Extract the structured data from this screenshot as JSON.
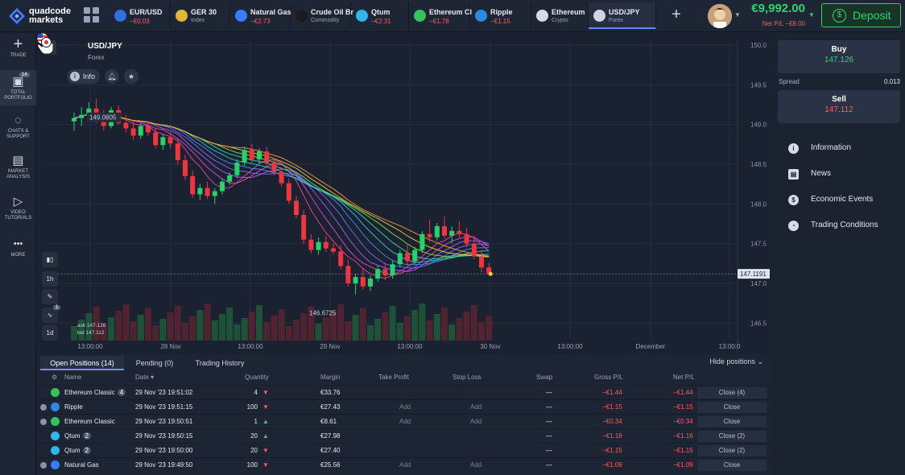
{
  "app": {
    "brand_line1": "quadcode",
    "brand_line2": "markets"
  },
  "tabs": [
    {
      "name": "EUR/USD",
      "sub": "−€0.03",
      "sub_type": "pl",
      "color": "#2f6fe0",
      "active": false
    },
    {
      "name": "GER 30",
      "sub": "Index",
      "sub_type": "cat",
      "color": "#e3b63a",
      "active": false
    },
    {
      "name": "Natural Gas",
      "sub": "−€2.73",
      "sub_type": "pl",
      "color": "#3b7bff",
      "active": false
    },
    {
      "name": "Crude Oil Br",
      "sub": "Commodity",
      "sub_type": "cat",
      "color": "#1b1b1b",
      "active": false
    },
    {
      "name": "Qtum",
      "sub": "−€2.31",
      "sub_type": "pl",
      "color": "#2fb7e8",
      "active": false
    },
    {
      "name": "Ethereum Cl",
      "sub": "−€1.78",
      "sub_type": "pl",
      "color": "#33c45e",
      "active": false
    },
    {
      "name": "Ripple",
      "sub": "−€1.15",
      "sub_type": "pl",
      "color": "#2a8be6",
      "active": false
    },
    {
      "name": "Ethereum",
      "sub": "Crypto",
      "sub_type": "cat",
      "color": "#d8dbe2",
      "active": false
    },
    {
      "name": "USD/JPY",
      "sub": "Forex",
      "sub_type": "cat",
      "color": "#d0d5e0",
      "active": true
    }
  ],
  "account": {
    "balance": "€9,992.00",
    "net_pl": "Net P/L −€8.00",
    "deposit_label": "Deposit"
  },
  "sidebar": [
    {
      "key": "trade",
      "glyph": "+",
      "label": "TRADE"
    },
    {
      "key": "portfolio",
      "glyph": "▣",
      "label": "TOTAL PORTFOLIO",
      "badge": "14"
    },
    {
      "key": "chats",
      "glyph": "◌",
      "label": "CHATS & SUPPORT"
    },
    {
      "key": "market",
      "glyph": "▤",
      "label": "MARKET ANALYSIS"
    },
    {
      "key": "video",
      "glyph": "▷",
      "label": "VIDEO TUTORIALS"
    },
    {
      "key": "more",
      "glyph": "•••",
      "label": "MORE"
    }
  ],
  "chart_header": {
    "pair": "USD/JPY",
    "category": "Forex",
    "info_label": "Info"
  },
  "chart_tools": {
    "timeframe_1": "1h",
    "timeframe_2": "1d",
    "indicator_badge": "1"
  },
  "chart_data": {
    "type": "candlestick",
    "price_ticks": [
      "150.0",
      "149.5",
      "149.0",
      "148.5",
      "148.0",
      "147.5",
      "147.0",
      "146.5"
    ],
    "time_ticks": [
      "13:00:00",
      "28 Nov",
      "13:00:00",
      "29 Nov",
      "13:00:00",
      "30 Nov",
      "13:00:00",
      "December",
      "13:00:0"
    ],
    "ylim": [
      146.3,
      150.05
    ],
    "current_price": 147.1191,
    "current_price_label": "147.1191",
    "high_label": "149.0805",
    "low_label": "146.6725",
    "ask_label": "ask 147.126",
    "bid_label": "bid 147.112",
    "candles_ohlc": [
      [
        149.04,
        149.15,
        148.92,
        149.08
      ],
      [
        149.08,
        149.22,
        148.98,
        149.12
      ],
      [
        149.12,
        149.28,
        149.05,
        149.2
      ],
      [
        149.2,
        149.32,
        149.02,
        149.05
      ],
      [
        149.05,
        149.18,
        148.92,
        148.98
      ],
      [
        148.98,
        149.22,
        148.95,
        149.18
      ],
      [
        149.18,
        149.24,
        149.0,
        149.02
      ],
      [
        149.02,
        149.12,
        148.9,
        148.95
      ],
      [
        148.95,
        149.05,
        148.8,
        148.86
      ],
      [
        148.86,
        149.02,
        148.82,
        148.98
      ],
      [
        148.98,
        149.04,
        148.86,
        148.9
      ],
      [
        148.9,
        148.96,
        148.7,
        148.74
      ],
      [
        148.74,
        148.88,
        148.68,
        148.84
      ],
      [
        148.84,
        148.9,
        148.7,
        148.76
      ],
      [
        148.76,
        148.82,
        148.5,
        148.55
      ],
      [
        148.55,
        148.62,
        148.3,
        148.35
      ],
      [
        148.35,
        148.42,
        148.08,
        148.12
      ],
      [
        148.12,
        148.25,
        148.05,
        148.2
      ],
      [
        148.2,
        148.28,
        148.06,
        148.1
      ],
      [
        148.1,
        148.2,
        148.0,
        148.16
      ],
      [
        148.16,
        148.32,
        148.12,
        148.28
      ],
      [
        148.28,
        148.4,
        148.24,
        148.36
      ],
      [
        148.36,
        148.56,
        148.32,
        148.52
      ],
      [
        148.52,
        148.72,
        148.48,
        148.68
      ],
      [
        148.68,
        148.76,
        148.52,
        148.56
      ],
      [
        148.56,
        148.7,
        148.5,
        148.66
      ],
      [
        148.66,
        148.72,
        148.48,
        148.52
      ],
      [
        148.52,
        148.58,
        148.36,
        148.4
      ],
      [
        148.4,
        148.46,
        148.22,
        148.26
      ],
      [
        148.26,
        148.32,
        148.0,
        148.04
      ],
      [
        148.04,
        148.1,
        147.82,
        147.86
      ],
      [
        147.86,
        147.92,
        147.5,
        147.55
      ],
      [
        147.55,
        147.62,
        147.38,
        147.42
      ],
      [
        147.42,
        147.58,
        147.36,
        147.52
      ],
      [
        147.52,
        147.6,
        147.4,
        147.44
      ],
      [
        147.44,
        147.5,
        147.36,
        147.4
      ],
      [
        147.4,
        147.48,
        147.18,
        147.22
      ],
      [
        147.22,
        147.3,
        146.96,
        147.0
      ],
      [
        147.0,
        147.12,
        146.86,
        147.08
      ],
      [
        147.08,
        147.2,
        146.92,
        146.96
      ],
      [
        146.96,
        147.1,
        146.9,
        147.06
      ],
      [
        147.06,
        147.22,
        147.02,
        147.18
      ],
      [
        147.18,
        147.26,
        147.04,
        147.1
      ],
      [
        147.1,
        147.28,
        147.06,
        147.24
      ],
      [
        147.24,
        147.42,
        147.2,
        147.38
      ],
      [
        147.38,
        147.5,
        147.22,
        147.28
      ],
      [
        147.28,
        147.46,
        147.24,
        147.42
      ],
      [
        147.42,
        147.66,
        147.38,
        147.62
      ],
      [
        147.62,
        147.8,
        147.52,
        147.58
      ],
      [
        147.58,
        147.76,
        147.54,
        147.72
      ],
      [
        147.72,
        147.84,
        147.56,
        147.6
      ],
      [
        147.6,
        147.72,
        147.5,
        147.66
      ],
      [
        147.66,
        147.78,
        147.58,
        147.62
      ],
      [
        147.62,
        147.7,
        147.46,
        147.5
      ],
      [
        147.5,
        147.6,
        147.3,
        147.34
      ],
      [
        147.34,
        147.42,
        147.14,
        147.2
      ],
      [
        147.2,
        147.26,
        147.1,
        147.12
      ]
    ]
  },
  "trade_panel": {
    "buy_label": "Buy",
    "buy_price": "147.126",
    "sell_label": "Sell",
    "sell_price": "147.112",
    "spread_label": "Spread",
    "spread_value": "0.013"
  },
  "info_menu": [
    {
      "icon": "info-icon",
      "glyph": "i",
      "label": "Information"
    },
    {
      "icon": "news-icon",
      "glyph": "▤",
      "label": "News"
    },
    {
      "icon": "dollar-icon",
      "glyph": "$",
      "label": "Economic Events"
    },
    {
      "icon": "conditions-icon",
      "glyph": "◔",
      "label": "Trading Conditions"
    }
  ],
  "positions": {
    "tabs": [
      "Open Positions (14)",
      "Pending (0)",
      "Trading History"
    ],
    "hide_label": "Hide positions",
    "columns": [
      "Name",
      "Date",
      "Quantity",
      "Margin",
      "Take Profit",
      "Stop Loss",
      "Swap",
      "Gross P/L",
      "Net P/L"
    ],
    "rows": [
      {
        "info": false,
        "icon_color": "#33c45e",
        "name": "Ethereum Classic",
        "count": "4",
        "date": "29 Nov '23 19:51:02",
        "qty": "4",
        "dir": "down",
        "margin": "€33.76",
        "tp": "",
        "sl": "",
        "swap": "—",
        "gross": "−€1.44",
        "net": "−€1.44",
        "close": "Close (4)"
      },
      {
        "info": true,
        "icon_color": "#2a8be6",
        "name": "Ripple",
        "count": "",
        "date": "29 Nov '23 19:51:15",
        "qty": "100",
        "dir": "down",
        "margin": "€27.43",
        "tp": "Add",
        "sl": "Add",
        "swap": "—",
        "gross": "−€1.15",
        "net": "−€1.15",
        "close": "Close"
      },
      {
        "info": true,
        "icon_color": "#33c45e",
        "name": "Ethereum Classic",
        "count": "",
        "date": "29 Nov '23 19:50:51",
        "qty": "1",
        "dir": "up",
        "margin": "€8.61",
        "tp": "Add",
        "sl": "Add",
        "swap": "—",
        "gross": "−€0.34",
        "net": "−€0.34",
        "close": "Close"
      },
      {
        "info": false,
        "icon_color": "#2fb7e8",
        "name": "Qtum",
        "count": "2",
        "date": "29 Nov '23 19:50:15",
        "qty": "20",
        "dir": "up",
        "margin": "€27.98",
        "tp": "",
        "sl": "",
        "swap": "—",
        "gross": "−€1.16",
        "net": "−€1.16",
        "close": "Close (2)"
      },
      {
        "info": false,
        "icon_color": "#2fb7e8",
        "name": "Qtum",
        "count": "2",
        "date": "29 Nov '23 19:50:00",
        "qty": "20",
        "dir": "down",
        "margin": "€27.40",
        "tp": "",
        "sl": "",
        "swap": "—",
        "gross": "−€1.15",
        "net": "−€1.15",
        "close": "Close (2)"
      },
      {
        "info": true,
        "icon_color": "#3b7bff",
        "name": "Natural Gas",
        "count": "",
        "date": "29 Nov '23 19:49:50",
        "qty": "100",
        "dir": "down",
        "margin": "€25.56",
        "tp": "Add",
        "sl": "Add",
        "swap": "—",
        "gross": "−€1.09",
        "net": "−€1.09",
        "close": "Close"
      }
    ]
  }
}
